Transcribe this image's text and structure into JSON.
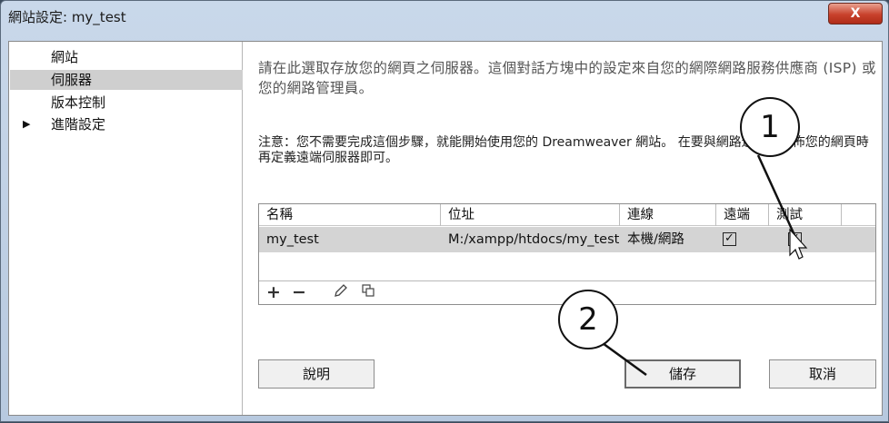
{
  "window": {
    "title": "網站設定: my_test",
    "close_label": "X"
  },
  "sidebar": {
    "items": [
      {
        "label": "網站"
      },
      {
        "label": "伺服器",
        "selected": true
      },
      {
        "label": "版本控制"
      },
      {
        "label": "進階設定",
        "expandable": true,
        "arrow": "▶"
      }
    ]
  },
  "main": {
    "description": "請在此選取存放您的網頁之伺服器。這個對話方塊中的設定來自您的網際網路服務供應商 (ISP) 或您的網路管理員。",
    "note": "注意：您不需要完成這個步驟，就能開始使用您的 Dreamweaver 網站。 在要與網路連線並發佈您的網頁時再定義遠端伺服器即可。",
    "table": {
      "headers": [
        "名稱",
        "位址",
        "連線",
        "遠端",
        "測試"
      ],
      "rows": [
        {
          "name": "my_test",
          "address": "M:/xampp/htdocs/my_test",
          "connection": "本機/網路",
          "remote": true,
          "test": true,
          "check_glyph": "✓"
        }
      ],
      "toolbar": [
        "add-icon",
        "remove-icon",
        "edit-icon",
        "duplicate-icon"
      ]
    }
  },
  "buttons": {
    "help": "說明",
    "save": "儲存",
    "cancel": "取消"
  },
  "callouts": [
    "1",
    "2"
  ],
  "colors": {
    "title_bar": "#c3d4e8",
    "selected_row": "#d4d4d4",
    "close_button": "#c8412c"
  }
}
